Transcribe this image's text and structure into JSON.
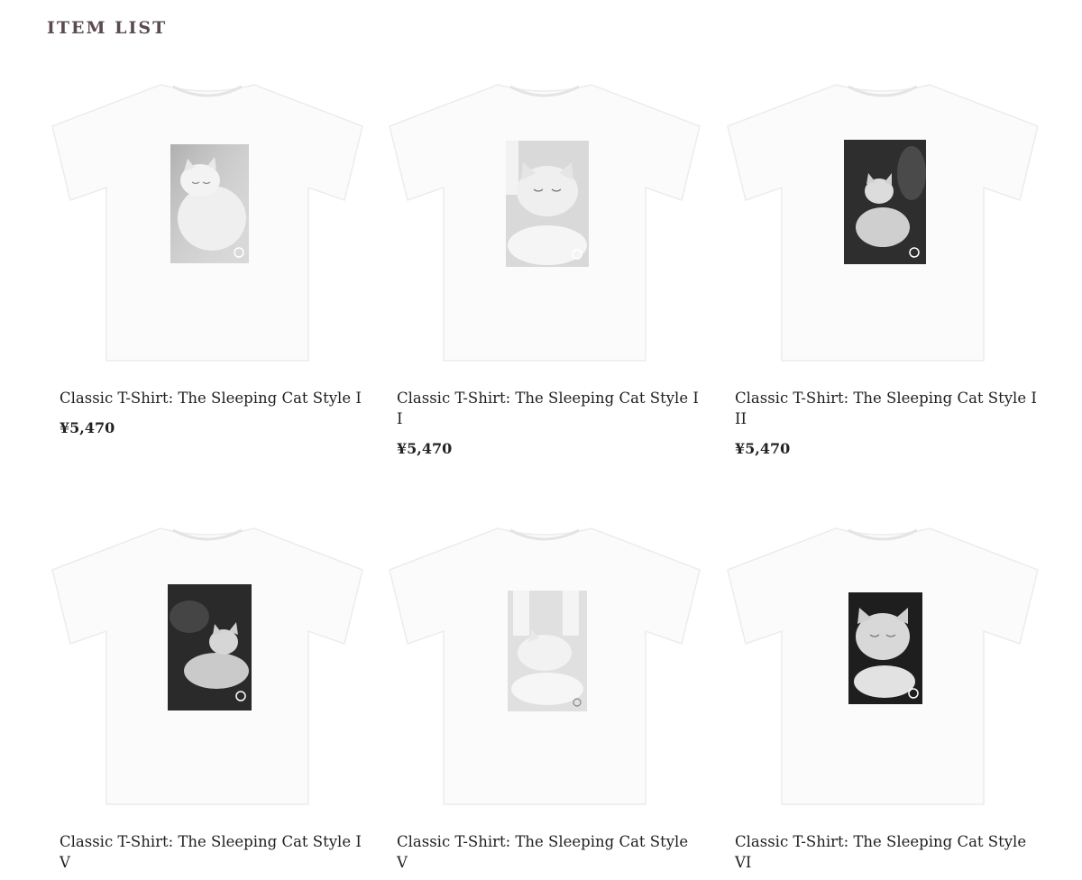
{
  "section_title": "ITEM LIST",
  "colors": {
    "title": "#5a4a4f",
    "shirt": "#fbfbfb",
    "shirt_shadow": "#eeeeee",
    "text": "#1f1f1f"
  },
  "items": [
    {
      "name": "Classic T-Shirt: The Sleeping Cat Style I",
      "price": "¥5,470",
      "print_tone": "light",
      "icon": "tshirt-print-icon"
    },
    {
      "name": "Classic T-Shirt: The Sleeping Cat Style II",
      "price": "¥5,470",
      "print_tone": "light",
      "icon": "tshirt-print-icon"
    },
    {
      "name": "Classic T-Shirt: The Sleeping Cat Style III",
      "price": "¥5,470",
      "print_tone": "dark",
      "icon": "tshirt-print-icon"
    },
    {
      "name": "Classic T-Shirt: The Sleeping Cat Style IV",
      "price": "",
      "print_tone": "dark",
      "icon": "tshirt-print-icon"
    },
    {
      "name": "Classic T-Shirt: The Sleeping Cat Style V",
      "price": "",
      "print_tone": "light",
      "icon": "tshirt-print-icon"
    },
    {
      "name": "Classic T-Shirt: The Sleeping Cat Style VI",
      "price": "",
      "print_tone": "dark",
      "icon": "tshirt-print-icon"
    }
  ]
}
